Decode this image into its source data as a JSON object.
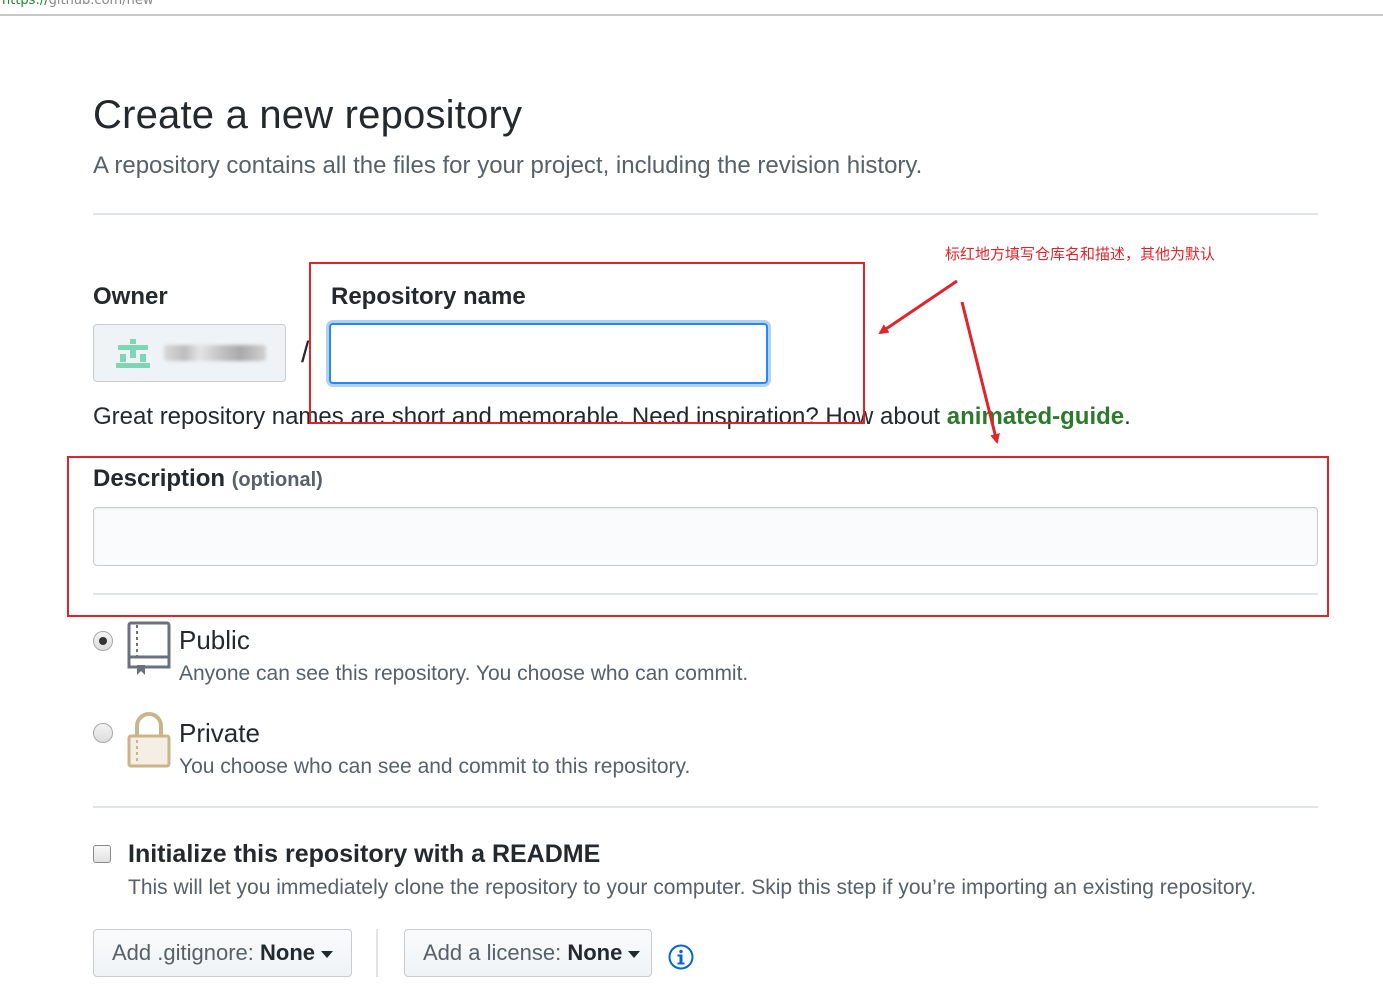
{
  "browser": {
    "url_protocol": "https://",
    "url_rest": "github.com/new"
  },
  "header": {
    "title": "Create a new repository",
    "subtitle": "A repository contains all the files for your project, including the revision history."
  },
  "form": {
    "owner_label": "Owner",
    "separator": "/",
    "repo_name_label": "Repository name",
    "repo_name_value": "",
    "hint_prefix": "Great repository names are short and memorable. Need inspiration? How about ",
    "hint_suggestion": "animated-guide",
    "hint_suffix": ".",
    "description_label": "Description",
    "description_optional": "(optional)",
    "description_value": ""
  },
  "visibility": {
    "selected": "public",
    "options": [
      {
        "id": "public",
        "title": "Public",
        "description": "Anyone can see this repository. You choose who can commit.",
        "icon": "repo-book-icon"
      },
      {
        "id": "private",
        "title": "Private",
        "description": "You choose who can see and commit to this repository.",
        "icon": "lock-icon"
      }
    ]
  },
  "init": {
    "checked": false,
    "title": "Initialize this repository with a README",
    "description": "This will let you immediately clone the repository to your computer. Skip this step if you’re importing an existing repository."
  },
  "selects": {
    "gitignore_label": "Add .gitignore:",
    "gitignore_value": "None",
    "license_label": "Add a license:",
    "license_value": "None"
  },
  "annotation": {
    "text": "标红地方填写仓库名和描述，其他为默认",
    "color": "#e0242b"
  },
  "colors": {
    "focus_blue": "#2188ff",
    "link_green": "#2c7a2c",
    "muted_text": "#586069"
  }
}
